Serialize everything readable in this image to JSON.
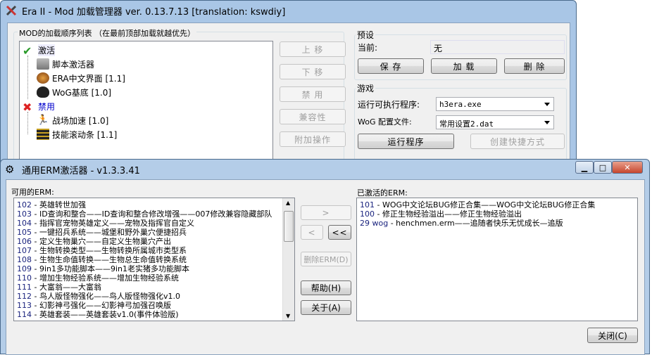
{
  "main_window": {
    "title": "Era II - Mod 加载管理器 ver. 0.13.7.13 [translation: kswdiy]",
    "mod_list_label": "MOD的加载顺序列表 （在最前顶部加载就越优先）",
    "tree": [
      {
        "label": "激活",
        "icon": "checkmark-icon",
        "children": [
          {
            "label": "脚本激活器",
            "icon": "folder-icon"
          },
          {
            "label": "ERA中文界面 [1.1]",
            "icon": "era-emblem-icon"
          },
          {
            "label": "WoG基底 [1.0]",
            "icon": "wog-eye-icon"
          }
        ]
      },
      {
        "label": "禁用",
        "icon": "red-x-icon",
        "children": [
          {
            "label": "战场加速 [1.0]",
            "icon": "running-man-icon"
          },
          {
            "label": "技能滚动条 [1.1]",
            "icon": "scrollbar-icon"
          }
        ]
      }
    ],
    "side_buttons": {
      "up": "上 移",
      "down": "下 移",
      "disable": "禁 用",
      "compat": "兼容性",
      "extra": "附加操作"
    },
    "preset": {
      "group": "预设",
      "current_label": "当前:",
      "current_value": "无",
      "save": "保 存",
      "load": "加 载",
      "delete": "删 除"
    },
    "game": {
      "group": "游戏",
      "exe_label": "运行可执行程序:",
      "exe_value": "h3era.exe",
      "wog_label": "WoG 配置文件:",
      "wog_value": "常用设置2.dat",
      "run": "运行程序",
      "shortcut": "创建快捷方式"
    }
  },
  "erm_window": {
    "title": "通用ERM激活器 - v1.3.3.41",
    "available_label": "可用的ERM:",
    "available": [
      {
        "n": "102",
        "t": "英雄转世加强"
      },
      {
        "n": "103",
        "t": "ID查询和整合——ID查询和整合修改增强——007修改兼容隐藏部队"
      },
      {
        "n": "104",
        "t": "指挥官宠物英雄定义——宠物及指挥官自定义"
      },
      {
        "n": "105",
        "t": "一键招兵系统——城堡和野外巢穴便捷招兵"
      },
      {
        "n": "106",
        "t": "定义生物巢穴——自定义生物巢穴产出"
      },
      {
        "n": "107",
        "t": "生物转换类型——生物转换所属城市类型系"
      },
      {
        "n": "108",
        "t": "生物生命值转换——生物总生命值转换系统"
      },
      {
        "n": "109",
        "t": "9in1多功能脚本——9in1老实猪多功能脚本"
      },
      {
        "n": "110",
        "t": "增加生物经验系统——增加生物经验系统"
      },
      {
        "n": "111",
        "t": "大富翁——大富翁"
      },
      {
        "n": "112",
        "t": "鸟人版怪物强化——鸟人版怪物强化v1.0"
      },
      {
        "n": "113",
        "t": "幻影神弓强化——幻影神弓加强召唤版"
      },
      {
        "n": "114",
        "t": "英雄套装——英雄套装v1.0(事件体验版)"
      }
    ],
    "active_label": "已激活的ERM:",
    "active": [
      {
        "n": "101",
        "t": "WOG中文论坛BUG修正合集——WOG中文论坛BUG修正合集"
      },
      {
        "n": "100",
        "t": "修正生物经验溢出——修正生物经验溢出"
      },
      {
        "n": "29 wog",
        "t": "henchmen.erm——追随者快乐无忧成长—追版"
      }
    ],
    "buttons": {
      "add": ">",
      "remove": "<",
      "remove_all": "<<",
      "delete": "删除ERM(D)",
      "help": "帮助(H)",
      "about": "关于(A)",
      "close": "关闭(C)"
    },
    "caption": {
      "min": "▁",
      "max": "□",
      "close": "✕"
    }
  }
}
